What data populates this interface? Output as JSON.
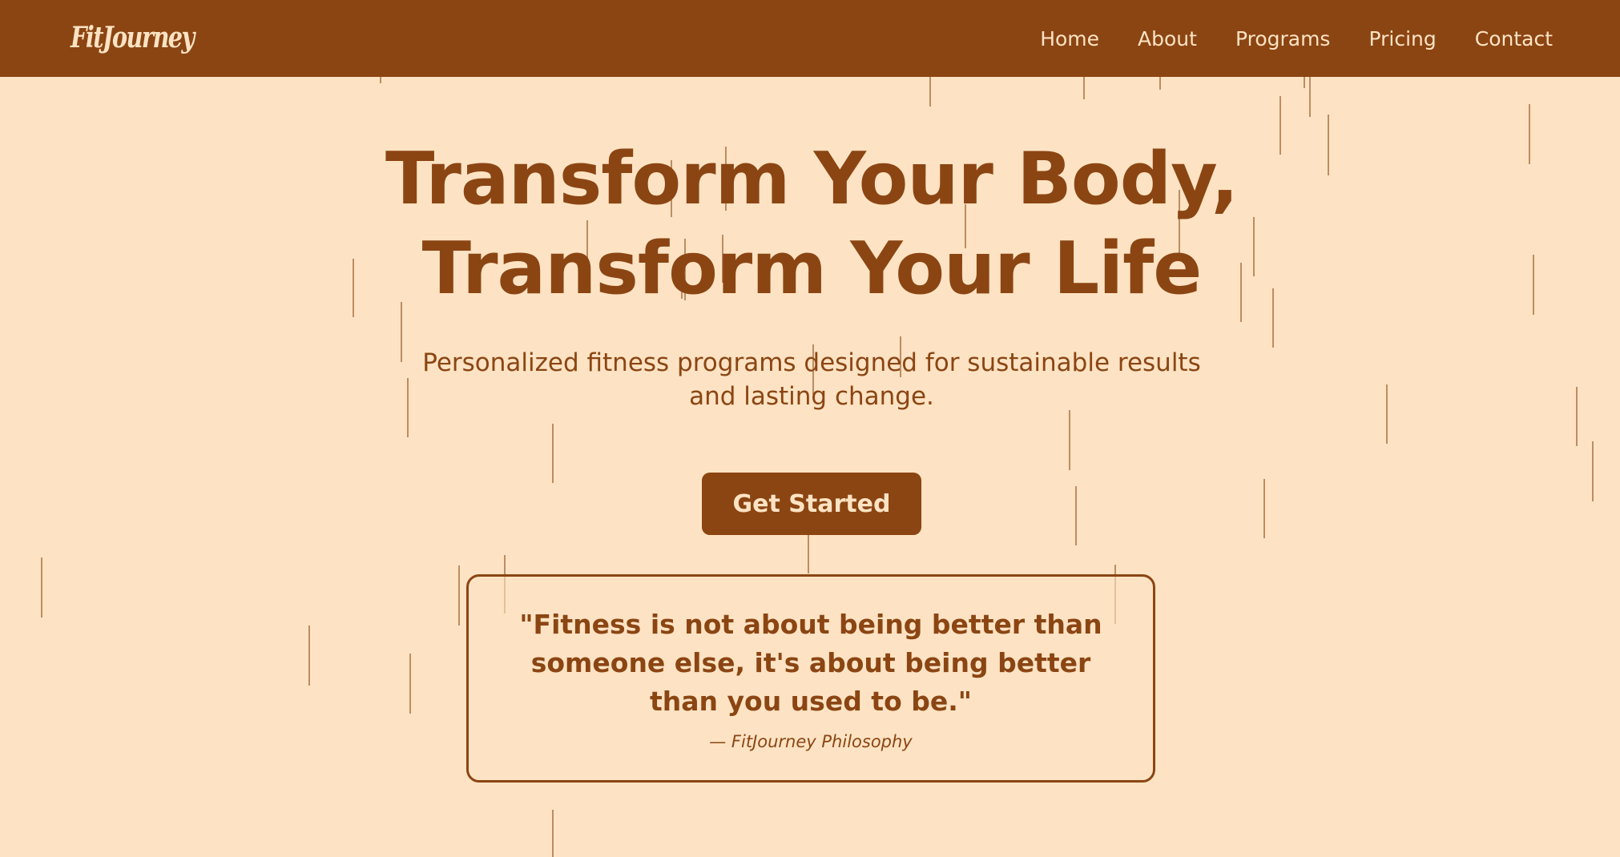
{
  "brand": {
    "logo": "FitJourney"
  },
  "nav": {
    "links": [
      "Home",
      "About",
      "Programs",
      "Pricing",
      "Contact"
    ]
  },
  "hero": {
    "headline_line1": "Transform Your Body,",
    "headline_line2": "Transform Your Life",
    "subtitle_line1": "Personalized fitness programs designed for sustainable results",
    "subtitle_line2": "and lasting change.",
    "cta_label": "Get Started"
  },
  "quote": {
    "text": "\"Fitness is not about being better than someone else, it's about being better than you used to be.\"",
    "attribution": "— FitJourney Philosophy"
  },
  "colors": {
    "primary": "#8B4513",
    "background": "#FDE3C3",
    "nav_text": "#FDE3C3"
  }
}
